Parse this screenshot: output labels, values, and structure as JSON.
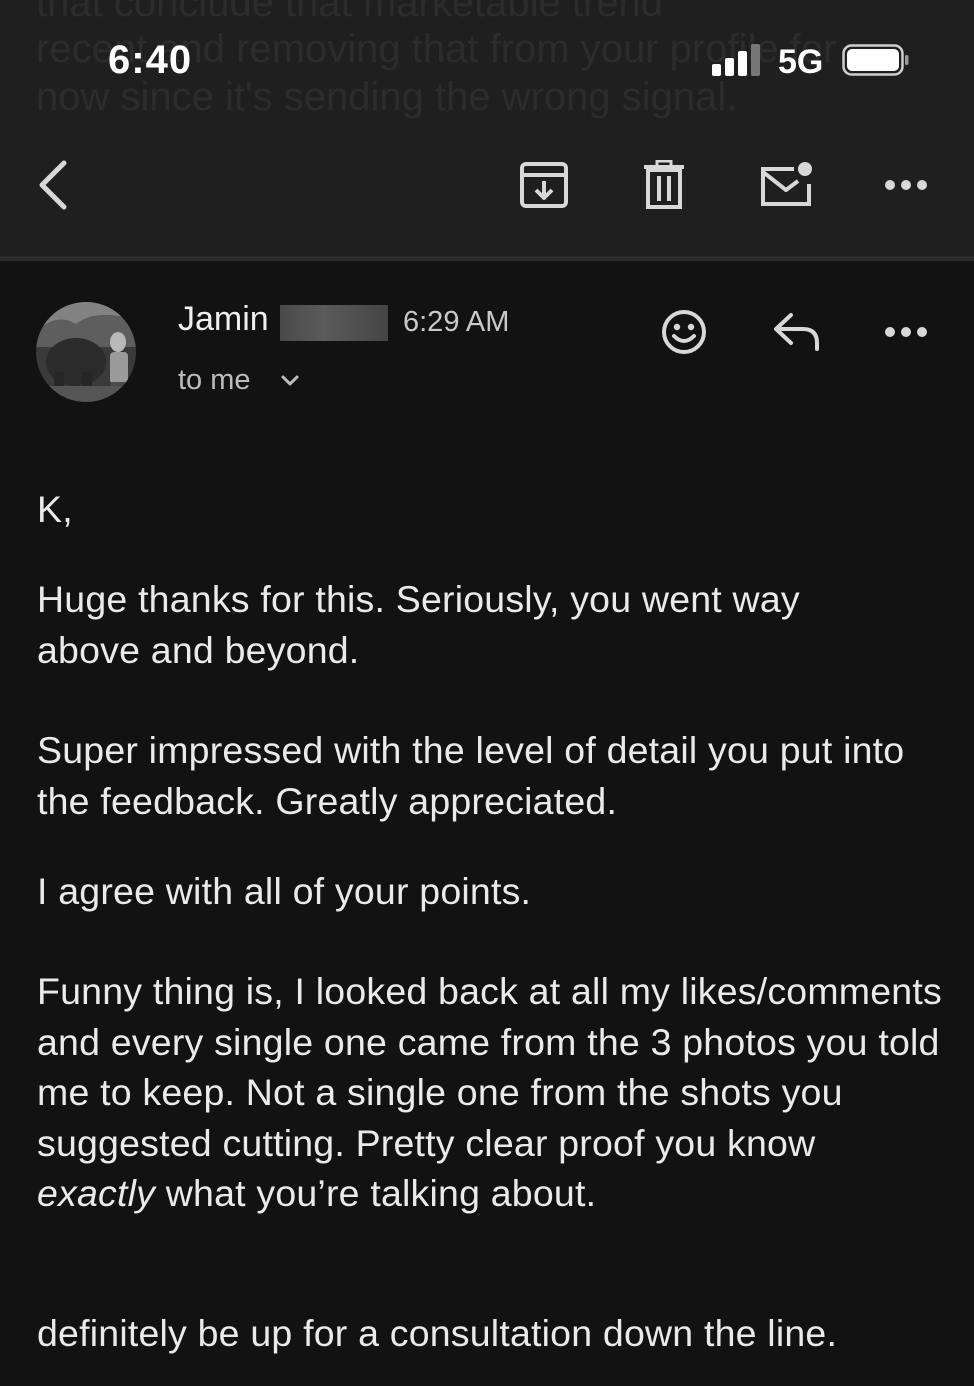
{
  "status_bar": {
    "time": "6:40",
    "network": "5G"
  },
  "background_preview": {
    "line1": "that conclude that marketable trend",
    "line2": "recent and removing that from your profile for",
    "line3": "now since it's sending the wrong signal."
  },
  "toolbar": {
    "icons": [
      "back-icon",
      "archive-icon",
      "trash-icon",
      "mark-unread-icon",
      "more-icon"
    ]
  },
  "message": {
    "sender_name": "Jamin",
    "time": "6:29 AM",
    "recipient": "to me",
    "body": {
      "greeting": "K,",
      "para1": "Huge thanks for this. Seriously, you went way above and beyond.",
      "para2": "Super impressed with the level of detail you put into the feedback. Greatly appreciated.",
      "para3": "I agree with all of your points.",
      "para4_before": "Funny thing is, I looked back at all my likes/comments and every single one came from the 3 photos you told me to keep. Not a single one from the shots you suggested cutting. Pretty clear proof you know ",
      "para4_emph": "exactly",
      "para4_after": " what you’re talking about.",
      "para5": "definitely be up for a consultation down the line."
    }
  }
}
